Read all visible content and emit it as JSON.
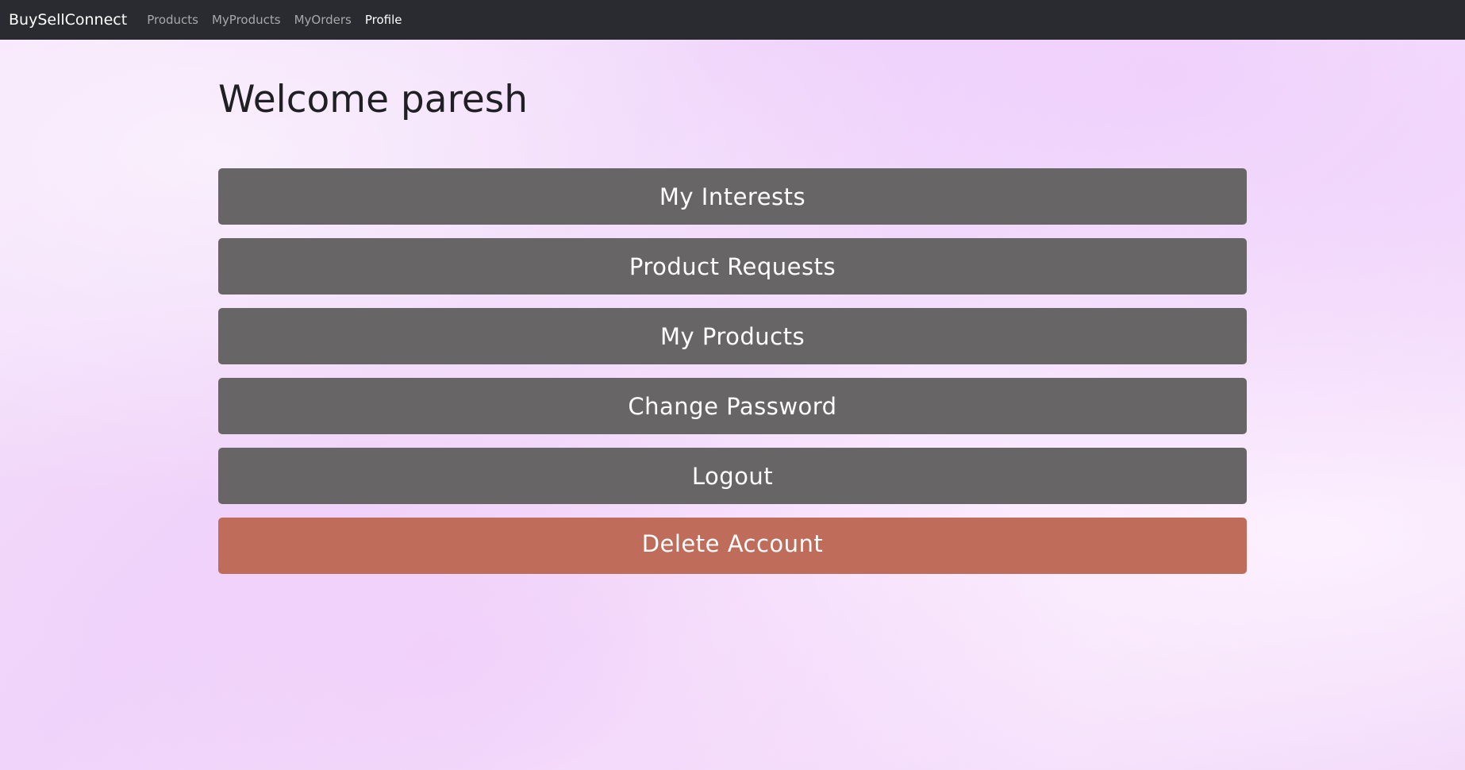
{
  "navbar": {
    "brand": "BuySellConnect",
    "links": [
      "Products",
      "MyProducts",
      "MyOrders",
      "Profile"
    ],
    "active": "Profile"
  },
  "main": {
    "welcome": "Welcome paresh",
    "buttons": {
      "my_interests": "My Interests",
      "product_requests": "Product Requests",
      "my_products": "My Products",
      "change_password": "Change Password",
      "logout": "Logout",
      "delete_account": "Delete Account"
    }
  },
  "colors": {
    "navbar": "#2a2b30",
    "button": "#686566",
    "danger": "#bf6c5a"
  }
}
